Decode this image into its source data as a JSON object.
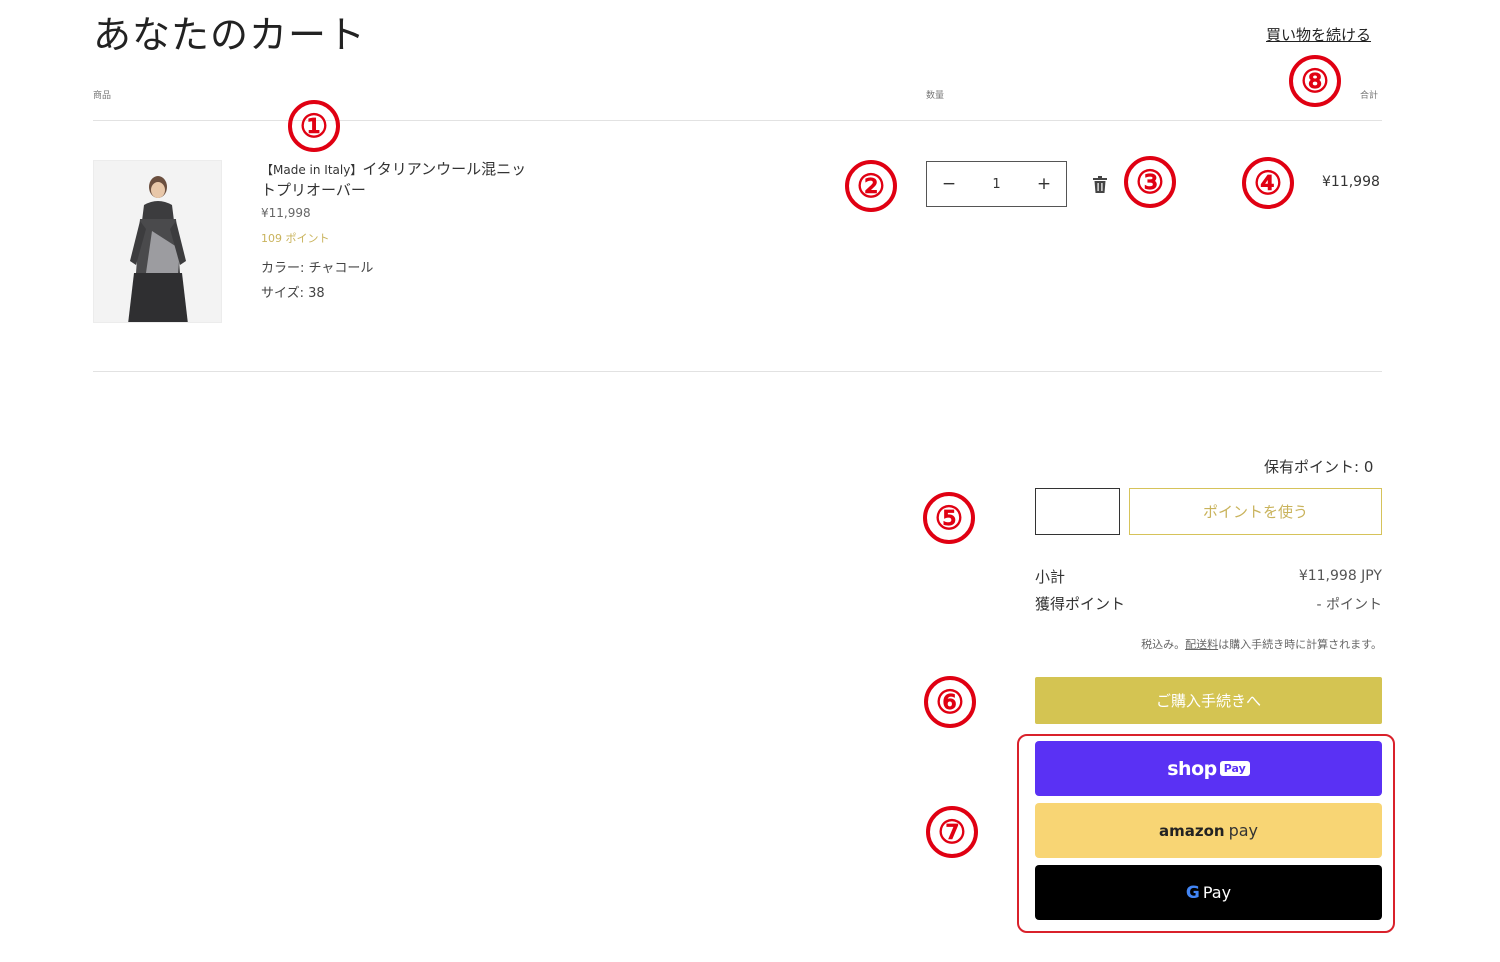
{
  "page": {
    "title": "あなたのカート",
    "continue_link": "買い物を続ける"
  },
  "columns": {
    "product": "商品",
    "quantity": "数量",
    "total": "合計"
  },
  "item": {
    "name_prefix": "【Made in Italy】",
    "name_line1": "イタリアンウール混ニッ",
    "name_line2": "トプリオーバー",
    "price": "¥11,998",
    "points": "109 ポイント",
    "color": "カラー: チャコール",
    "size": "サイズ: 38",
    "quantity": "1",
    "minus": "−",
    "plus": "+",
    "line_total": "¥11,998"
  },
  "points": {
    "held": "保有ポイント: 0",
    "use_button": "ポイントを使う"
  },
  "summary": {
    "subtotal_label": "小計",
    "subtotal_value": "¥11,998 JPY",
    "earned_label": "獲得ポイント",
    "earned_value": "- ポイント",
    "note_pre": "税込み。",
    "note_link": "配送料",
    "note_post": "は購入手続き時に計算されます。"
  },
  "checkout": {
    "label": "ご購入手続きへ"
  },
  "express": {
    "shoppay_word": "shop",
    "shoppay_badge": "Pay",
    "amazon_word": "amazon",
    "amazon_pay": "pay",
    "gpay_g": "G",
    "gpay_word": "Pay"
  },
  "annotations": [
    "①",
    "②",
    "③",
    "④",
    "⑤",
    "⑥",
    "⑦",
    "⑧"
  ],
  "colors": {
    "accent_gold": "#d4c452",
    "annotation_red": "#e00012",
    "shoppay": "#5a31f4",
    "amazonpay": "#f8d574",
    "gpay": "#000000"
  }
}
